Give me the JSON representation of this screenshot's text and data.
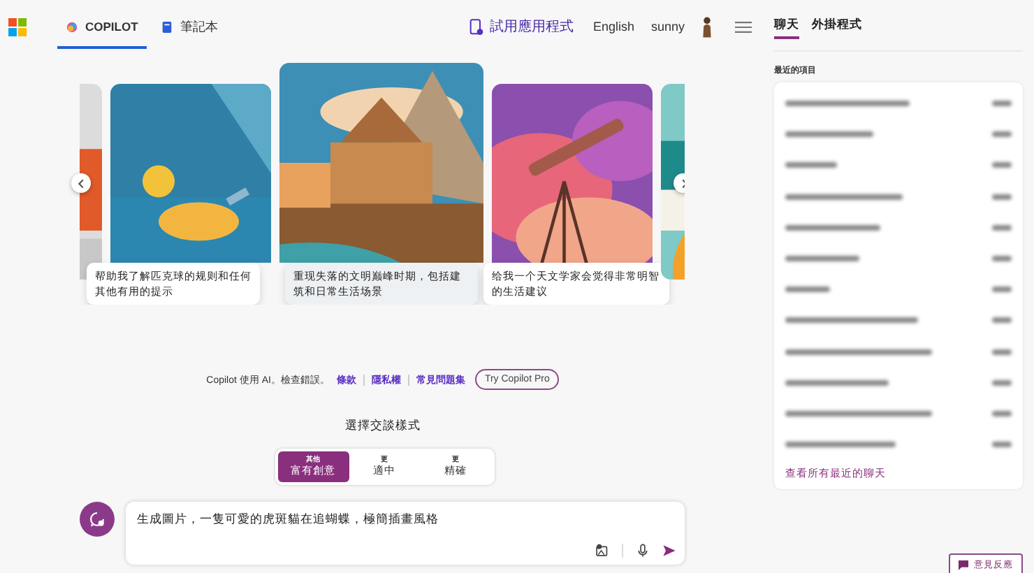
{
  "header": {
    "tabs": [
      {
        "label": "COPILOT",
        "selected": true,
        "kind": "copilot"
      },
      {
        "label": "筆記本",
        "selected": false,
        "kind": "notebook"
      }
    ],
    "try_app": "試用應用程式",
    "language": "English",
    "user": "sunny"
  },
  "carousel": {
    "cards": [
      {
        "kind": "partial-left"
      },
      {
        "kind": "paddle",
        "caption": "帮助我了解匹克球的规则和任何其他有用的提示"
      },
      {
        "kind": "temple",
        "caption": "重现失落的文明巅峰时期，包括建筑和日常生活场景"
      },
      {
        "kind": "telescope",
        "caption": "给我一个天文学家会觉得非常明智的生活建议"
      },
      {
        "kind": "partial-right"
      }
    ]
  },
  "notice": {
    "text": "Copilot 使用 AI。檢查錯誤。",
    "links": [
      "條款",
      "隱私權",
      "常見問題集"
    ],
    "pro_button": "Try Copilot Pro"
  },
  "mode": {
    "title": "選擇交談樣式",
    "options": [
      {
        "small": "其他",
        "label": "富有創意",
        "selected": true
      },
      {
        "small": "更",
        "label": "適中",
        "selected": false
      },
      {
        "small": "更",
        "label": "精確",
        "selected": false
      }
    ]
  },
  "input": {
    "value": "生成圖片，一隻可愛的虎斑貓在追蝴蝶，極簡插畫風格"
  },
  "sidebar": {
    "tabs": [
      {
        "label": "聊天",
        "selected": true
      },
      {
        "label": "外掛程式",
        "selected": false
      }
    ],
    "section": "最近的項目",
    "see_all": "查看所有最近的聊天"
  },
  "feedback": "意見反應"
}
